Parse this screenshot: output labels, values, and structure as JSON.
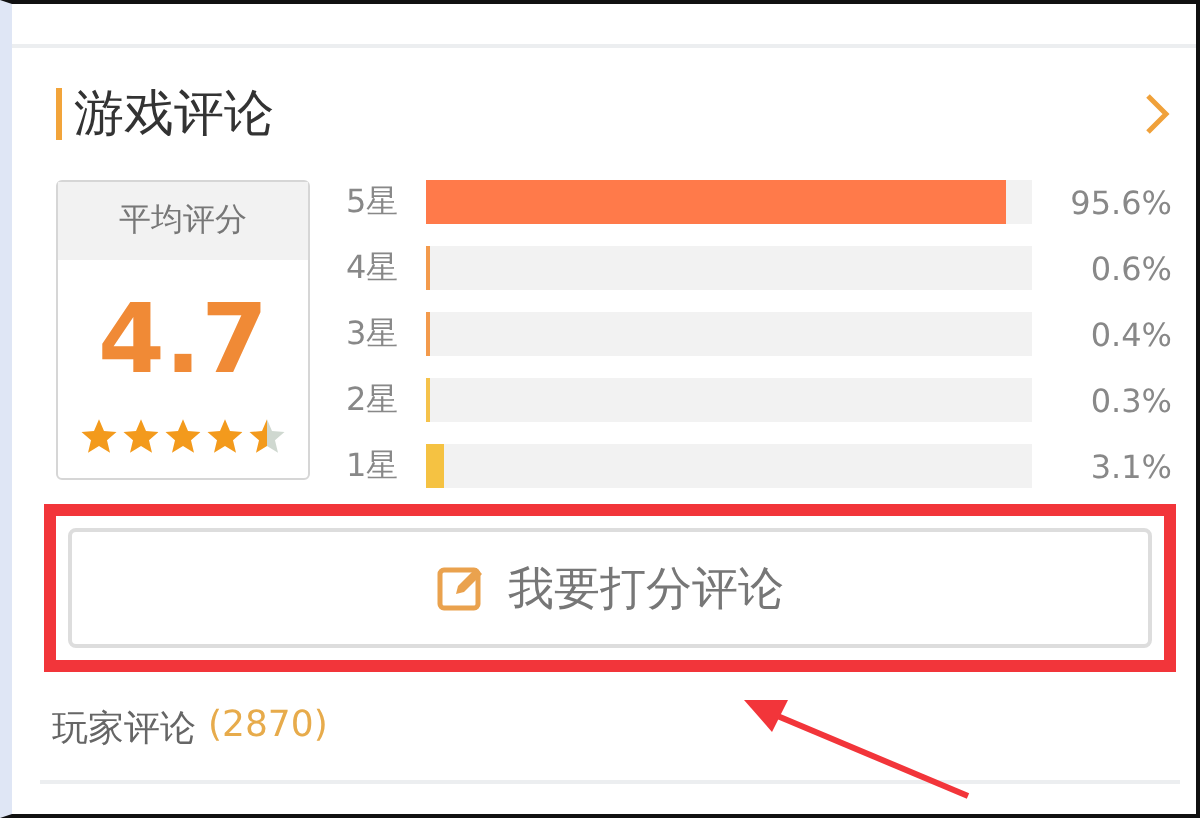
{
  "section": {
    "title": "游戏评论"
  },
  "average": {
    "label": "平均评分",
    "score": "4.7",
    "stars": 4.5
  },
  "distribution": [
    {
      "label": "5星",
      "level": 0.956,
      "percent": "95.6%",
      "color": "#ff7a4a"
    },
    {
      "label": "4星",
      "level": 0.006,
      "percent": "0.6%",
      "color": "#f39a4c"
    },
    {
      "label": "3星",
      "level": 0.004,
      "percent": "0.4%",
      "color": "#f39a4c"
    },
    {
      "label": "2星",
      "level": 0.003,
      "percent": "0.3%",
      "color": "#f5c24a"
    },
    {
      "label": "1星",
      "level": 0.031,
      "percent": "3.1%",
      "color": "#f5c242"
    }
  ],
  "rate_button": {
    "label": "我要打分评论",
    "highlighted": true
  },
  "player_reviews": {
    "label": "玩家评论",
    "count": "(2870)"
  }
}
